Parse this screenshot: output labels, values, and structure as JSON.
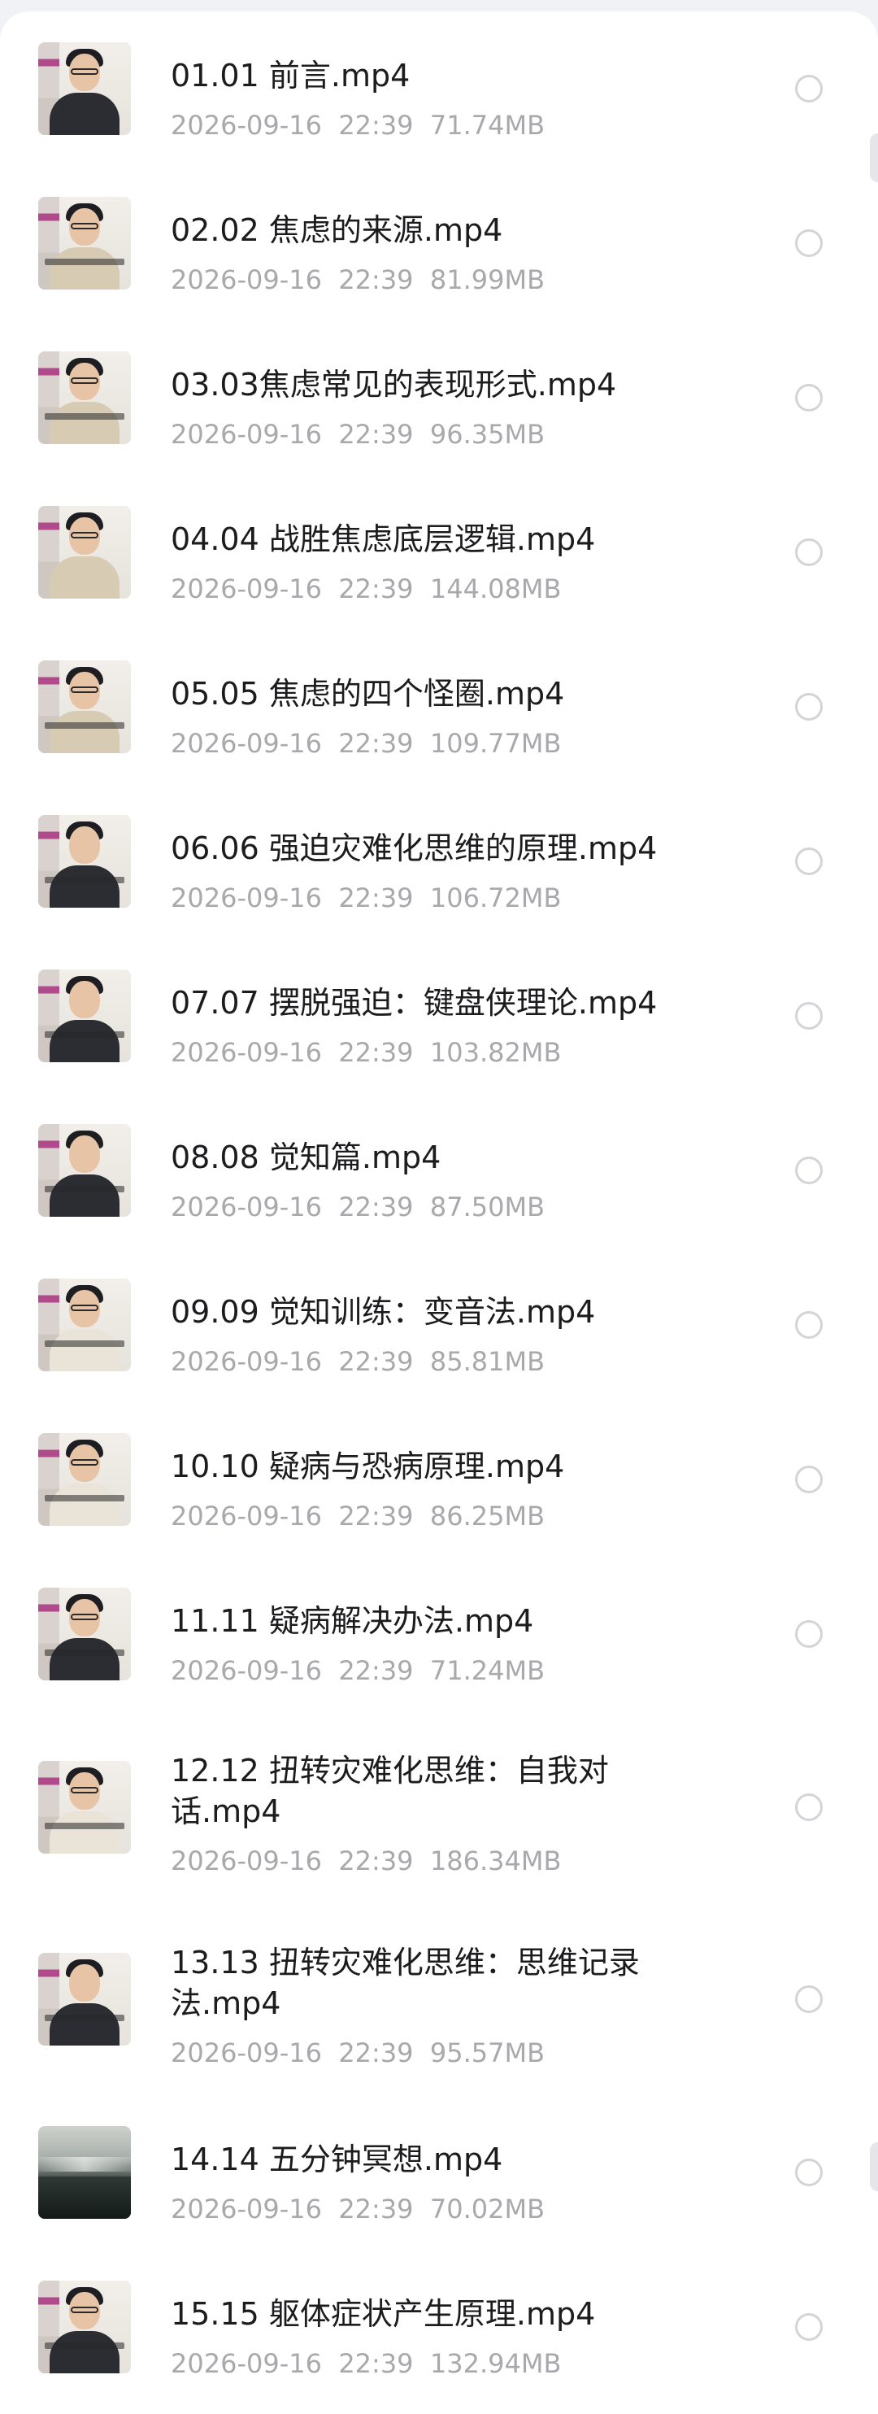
{
  "files": [
    {
      "name": "01.01 前言.mp4",
      "date": "2026-09-16",
      "time": "22:39",
      "size": "71.74MB",
      "thumb": "video-thumbnail"
    },
    {
      "name": "02.02 焦虑的来源.mp4",
      "date": "2026-09-16",
      "time": "22:39",
      "size": "81.99MB",
      "thumb": "video-thumbnail"
    },
    {
      "name": "03.03焦虑常见的表现形式.mp4",
      "date": "2026-09-16",
      "time": "22:39",
      "size": "96.35MB",
      "thumb": "video-thumbnail"
    },
    {
      "name": "04.04 战胜焦虑底层逻辑.mp4",
      "date": "2026-09-16",
      "time": "22:39",
      "size": "144.08MB",
      "thumb": "video-thumbnail"
    },
    {
      "name": "05.05 焦虑的四个怪圈.mp4",
      "date": "2026-09-16",
      "time": "22:39",
      "size": "109.77MB",
      "thumb": "video-thumbnail"
    },
    {
      "name": "06.06 强迫灾难化思维的原理.mp4",
      "date": "2026-09-16",
      "time": "22:39",
      "size": "106.72MB",
      "thumb": "video-thumbnail"
    },
    {
      "name": "07.07 摆脱强迫：键盘侠理论.mp4",
      "date": "2026-09-16",
      "time": "22:39",
      "size": "103.82MB",
      "thumb": "video-thumbnail"
    },
    {
      "name": "08.08 觉知篇.mp4",
      "date": "2026-09-16",
      "time": "22:39",
      "size": "87.50MB",
      "thumb": "video-thumbnail"
    },
    {
      "name": "09.09 觉知训练：变音法.mp4",
      "date": "2026-09-16",
      "time": "22:39",
      "size": "85.81MB",
      "thumb": "video-thumbnail"
    },
    {
      "name": "10.10 疑病与恐病原理.mp4",
      "date": "2026-09-16",
      "time": "22:39",
      "size": "86.25MB",
      "thumb": "video-thumbnail"
    },
    {
      "name": "11.11 疑病解决办法.mp4",
      "date": "2026-09-16",
      "time": "22:39",
      "size": "71.24MB",
      "thumb": "video-thumbnail"
    },
    {
      "name": "12.12 扭转灾难化思维：自我对话.mp4",
      "date": "2026-09-16",
      "time": "22:39",
      "size": "186.34MB",
      "thumb": "video-thumbnail"
    },
    {
      "name": "13.13 扭转灾难化思维：思维记录法.mp4",
      "date": "2026-09-16",
      "time": "22:39",
      "size": "95.57MB",
      "thumb": "video-thumbnail"
    },
    {
      "name": "14.14 五分钟冥想.mp4",
      "date": "2026-09-16",
      "time": "22:39",
      "size": "70.02MB",
      "thumb": "landscape-thumbnail"
    },
    {
      "name": "15.15 躯体症状产生原理.mp4",
      "date": "2026-09-16",
      "time": "22:39",
      "size": "132.94MB",
      "thumb": "video-thumbnail"
    }
  ]
}
